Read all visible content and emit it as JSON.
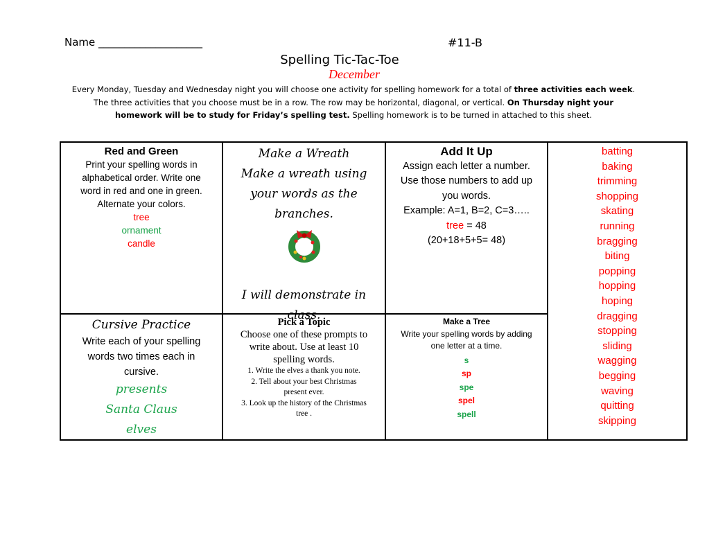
{
  "header": {
    "name_label": "Name ____________________",
    "number": "#11-B",
    "title": "Spelling Tic-Tac-Toe",
    "month": "December",
    "instr1a": "Every Monday, Tuesday and Wednesday night you will choose one activity for spelling homework for a total of ",
    "instr1b": "three activities each week",
    "instr2a": "The three activities that you choose must be in a row.  The row may be horizontal, diagonal, or vertical.  ",
    "instr2b": "On Thursday night your",
    "instr3a": "homework will be to study for Friday’s spelling test.",
    "instr3b": "  Spelling homework is to be turned in attached to this sheet."
  },
  "cells": {
    "red_green": {
      "title": "Red and Green",
      "lines": [
        "Print your spelling words in",
        "alphabetical order.  Write one",
        "word in red and one in green.",
        "Alternate your colors."
      ],
      "examples": [
        "tree",
        "ornament",
        "candle"
      ]
    },
    "wreath": {
      "title": "Make a Wreath",
      "lines": [
        "Make a wreath using",
        "your words as the",
        "branches."
      ],
      "footer": [
        "I will demonstrate in",
        "class."
      ]
    },
    "add_it_up": {
      "title": "Add It Up",
      "lines": [
        "Assign each letter a number.",
        "Use those numbers to add up",
        "you words.",
        "Example:   A=1, B=2, C=3….."
      ],
      "example_word": "tree",
      "example_eq": " = 48",
      "sum": "(20+18+5+5= 48)"
    },
    "cursive": {
      "title": "Cursive Practice",
      "lines": [
        "Write each of your spelling",
        "words two times each in",
        "cursive."
      ],
      "examples": [
        "presents",
        "Santa Claus",
        "elves"
      ]
    },
    "topic": {
      "title": "Pick a Topic",
      "lines": [
        "Choose one of these prompts to",
        "write about.  Use at least 10",
        "spelling words."
      ],
      "prompts": [
        "1.  Write the elves a thank you note.",
        "2.  Tell about your best Christmas",
        "present ever.",
        "3.  Look up the history of the Christmas",
        "tree ."
      ]
    },
    "tree": {
      "title": "Make a Tree",
      "lines": [
        "Write your spelling words by adding",
        "one letter at a time."
      ],
      "steps": [
        "s",
        "sp",
        "spe",
        "spel",
        "spell"
      ]
    }
  },
  "words": [
    "batting",
    "baking",
    "trimming",
    "shopping",
    "skating",
    "running",
    "bragging",
    "biting",
    "popping",
    "hopping",
    "hoping",
    "dragging",
    "stopping",
    "sliding",
    "wagging",
    "begging",
    "waving",
    "quitting",
    "skipping"
  ],
  "colors": {
    "red": "#ff0000",
    "green": "#1aa34a"
  }
}
